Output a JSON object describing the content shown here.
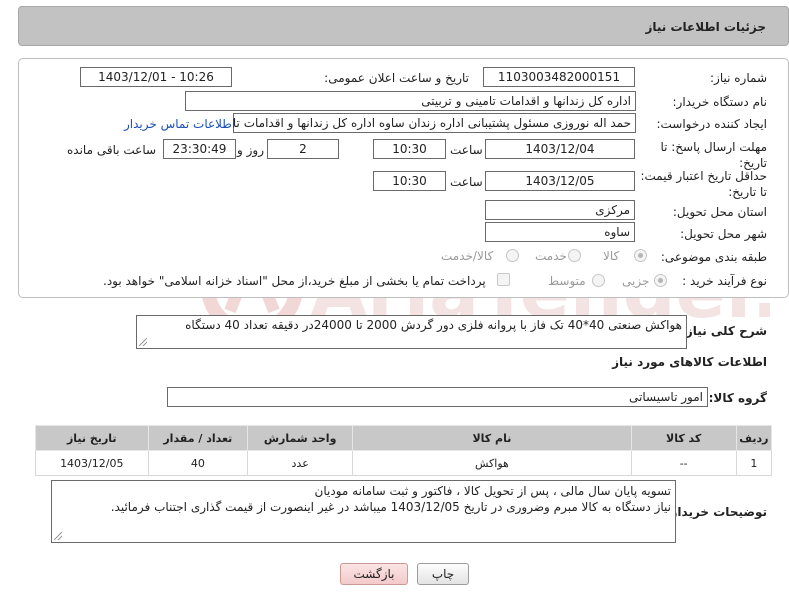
{
  "header": {
    "title": "جزئیات اطلاعات نیاز"
  },
  "form": {
    "need_number": {
      "label": "شماره نیاز:",
      "value": "1103003482000151"
    },
    "announce_datetime": {
      "label": "تاریخ و ساعت اعلان عمومی:",
      "value": "1403/12/01 - 10:26"
    },
    "buyer_org": {
      "label": "نام دستگاه خریدار:",
      "value": "اداره کل زندانها و اقدامات تامینی و تربیتی"
    },
    "requester": {
      "label": "ایجاد کننده درخواست:",
      "value": "حمد اله نوروزی مسئول پشتیبانی اداره زندان ساوه اداره کل زندانها و اقدامات تام",
      "link": "اطلاعات تماس خریدار"
    },
    "reply_deadline": {
      "label": "مهلت ارسال پاسخ: تا تاریخ:",
      "date": "1403/12/04",
      "time_label": "ساعت",
      "time": "10:30",
      "days": "2",
      "days_label": "روز و",
      "remaining": "23:30:49",
      "remaining_label": "ساعت باقی مانده"
    },
    "price_validity": {
      "label": "حداقل تاریخ اعتبار قیمت: تا تاریخ:",
      "date": "1403/12/05",
      "time_label": "ساعت",
      "time": "10:30"
    },
    "delivery_province": {
      "label": "استان محل تحویل:",
      "value": "مرکزی"
    },
    "delivery_city": {
      "label": "شهر محل تحویل:",
      "value": "ساوه"
    },
    "category": {
      "label": "طبقه بندی موضوعی:",
      "options": [
        "کالا",
        "خدمت",
        "کالا/خدمت"
      ],
      "selected": "کالا"
    },
    "purchase_type": {
      "label": "نوع فرآیند خرید :",
      "options": [
        "جزیی",
        "متوسط"
      ],
      "selected": "جزیی",
      "payment_note": "پرداخت تمام یا بخشی از مبلغ خرید،از محل \"اسناد خزانه اسلامی\" خواهد بود."
    }
  },
  "description": {
    "label": "شرح کلی نیاز:",
    "value": "هواکش صنعتی 40*40 تک فاز با پروانه فلزی دور گردش 2000 تا 24000در دقیقه تعداد 40 دستگاه"
  },
  "goods_section": {
    "title": "اطلاعات کالاهای مورد نیاز"
  },
  "goods_group": {
    "label": "گروه کالا:",
    "value": "امور تاسیساتی"
  },
  "table": {
    "headers": [
      "ردیف",
      "کد کالا",
      "نام کالا",
      "واحد شمارش",
      "تعداد / مقدار",
      "تاریخ نیاز"
    ],
    "rows": [
      [
        "1",
        "--",
        "هواکش",
        "عدد",
        "40",
        "1403/12/05"
      ]
    ]
  },
  "buyer_notes": {
    "label": "توضیحات خریدار:",
    "lines": [
      "تسویه پایان سال مالی ، پس از تحویل کالا ، فاکتور و ثبت سامانه مودیان",
      "نیاز دستگاه به کالا مبرم وضروری در تاریخ 1403/12/05 میباشد در غیر اینصورت از قیمت گذاری اجتناب فرمائید."
    ]
  },
  "buttons": {
    "print": "چاپ",
    "back": "بازگشت"
  },
  "watermark": {
    "text": "AriaTender.neT"
  }
}
